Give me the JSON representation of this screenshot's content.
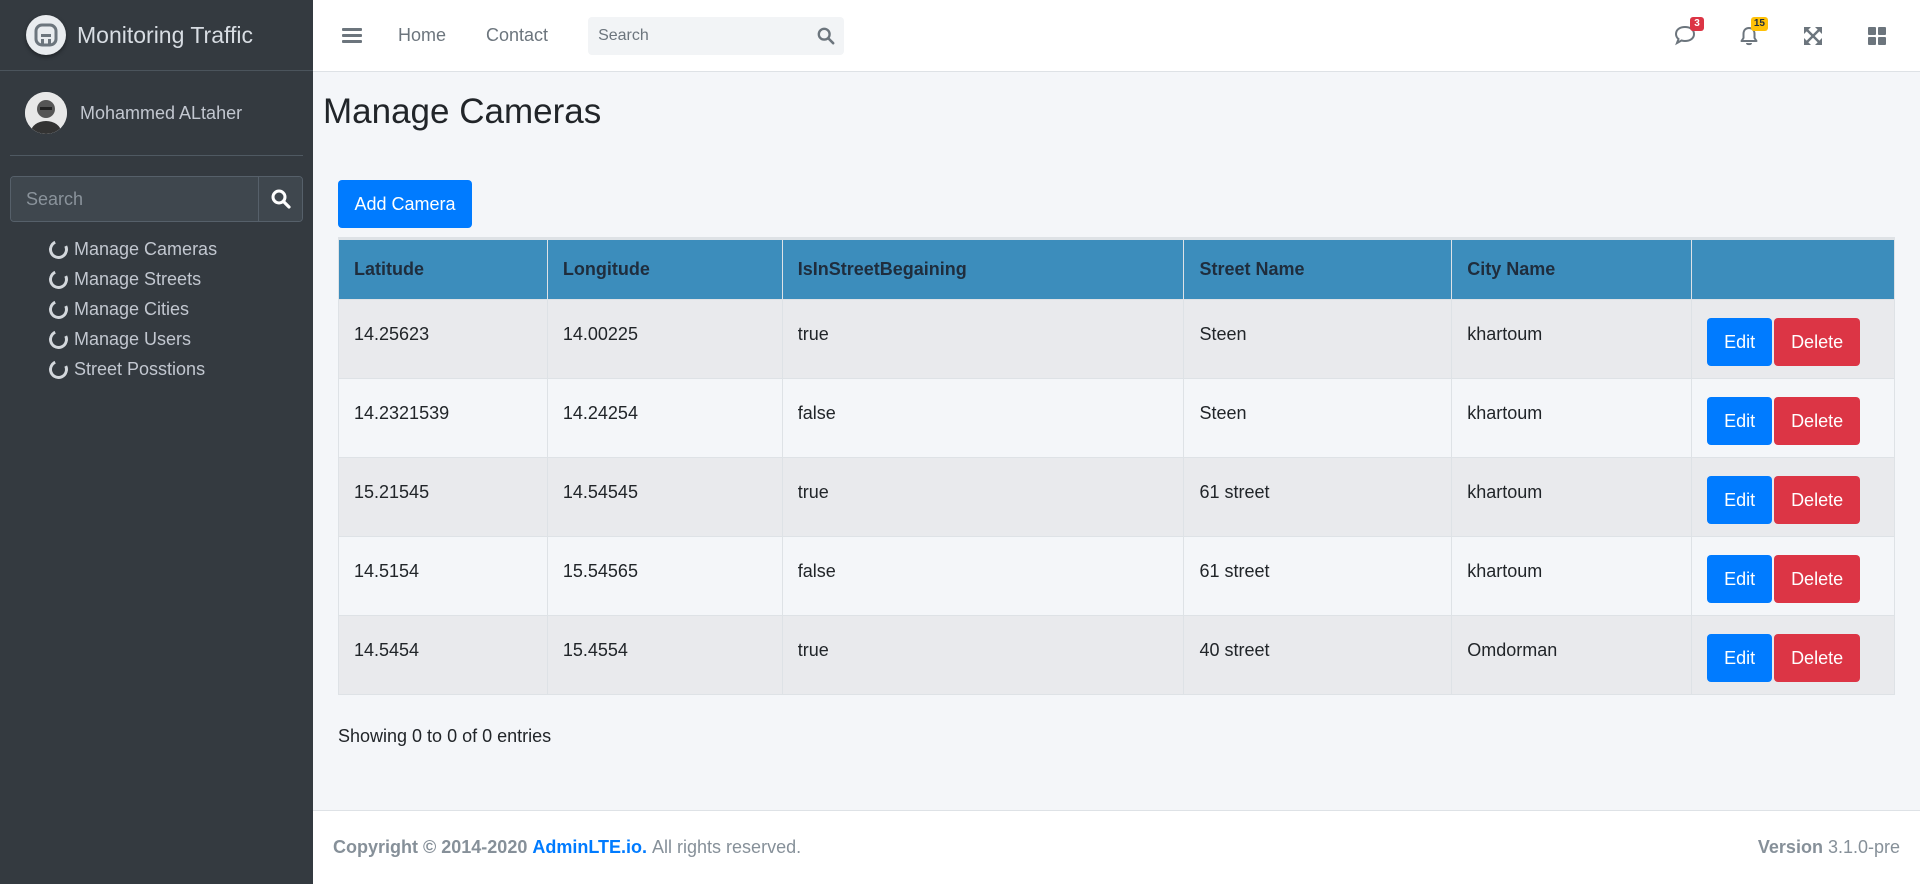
{
  "brand": {
    "name": "Monitoring Traffic",
    "logo_icon": "logo-a-icon"
  },
  "user": {
    "name": "Mohammed ALtaher",
    "avatar_icon": "user-avatar"
  },
  "sidebar": {
    "search_placeholder": "Search",
    "items": [
      {
        "label": "Manage Cameras"
      },
      {
        "label": "Manage Streets"
      },
      {
        "label": "Manage Cities"
      },
      {
        "label": "Manage Users"
      },
      {
        "label": "Street Posstions"
      }
    ]
  },
  "navbar": {
    "links": [
      "Home",
      "Contact"
    ],
    "search_placeholder": "Search",
    "messages_count": "3",
    "notifications_count": "15"
  },
  "page": {
    "title": "Manage Cameras",
    "add_button": "Add Camera",
    "columns": [
      "Latitude",
      "Longitude",
      "IsInStreetBegaining",
      "Street Name",
      "City Name",
      ""
    ],
    "rows": [
      [
        "14.25623",
        "14.00225",
        "true",
        "Steen",
        "khartoum"
      ],
      [
        "14.2321539",
        "14.24254",
        "false",
        "Steen",
        "khartoum"
      ],
      [
        "15.21545",
        "14.54545",
        "true",
        "61 street",
        "khartoum"
      ],
      [
        "14.5154",
        "15.54565",
        "false",
        "61 street",
        "khartoum"
      ],
      [
        "14.5454",
        "15.4554",
        "true",
        "40 street",
        "Omdorman"
      ]
    ],
    "edit_label": "Edit",
    "delete_label": "Delete",
    "entries_text": "Showing 0 to 0 of 0 entries"
  },
  "footer": {
    "copyright": "Copyright © 2014-2020",
    "link": "AdminLTE.io.",
    "rights": "All rights reserved.",
    "version_label": "Version",
    "version": "3.1.0-pre"
  },
  "colors": {
    "sidebar_bg": "#343a40",
    "table_header": "#3c8dbc",
    "primary": "#007bff",
    "danger": "#dc3545",
    "warning": "#ffc107"
  }
}
